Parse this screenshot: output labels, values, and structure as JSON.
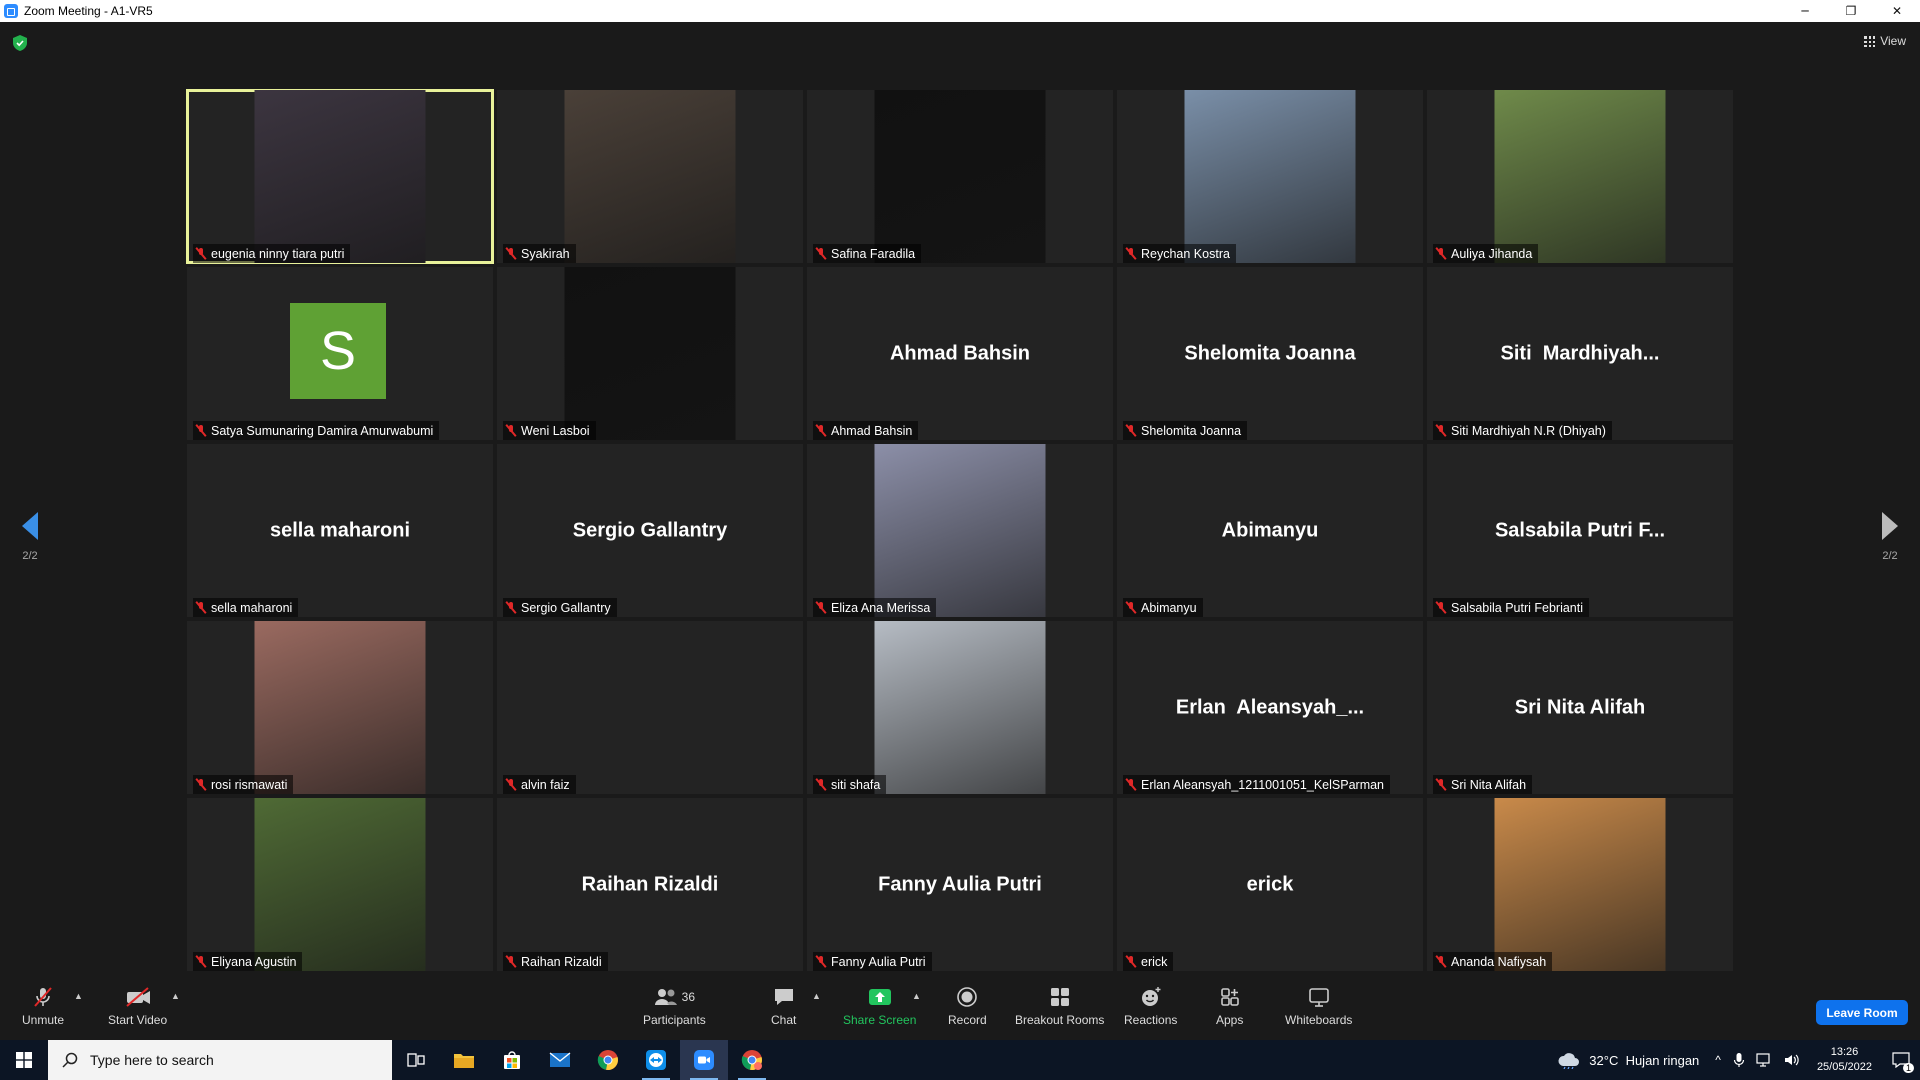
{
  "window": {
    "title": "Zoom Meeting - A1-VR5"
  },
  "view_label": "View",
  "pagination": {
    "left": "2/2",
    "right": "2/2"
  },
  "tiles": [
    {
      "display": "",
      "label": "eugenia ninny tiara putri",
      "type": "photo",
      "active": true,
      "photo_color": "#3c3540"
    },
    {
      "display": "",
      "label": "Syakirah",
      "type": "photo",
      "photo_color": "#4a4038"
    },
    {
      "display": "",
      "label": "Safina Faradila",
      "type": "photo",
      "photo_color": "#111111"
    },
    {
      "display": "",
      "label": "Reychan Kostra",
      "type": "photo",
      "photo_color": "#7a8fa8"
    },
    {
      "display": "",
      "label": "Auliya Jihanda",
      "type": "photo",
      "photo_color": "#6f8a4a"
    },
    {
      "display": "S",
      "label": "Satya Sumunaring Damira Amurwabumi",
      "type": "avatar"
    },
    {
      "display": "",
      "label": "Weni Lasboi",
      "type": "photo",
      "photo_color": "#111111"
    },
    {
      "display": "Ahmad Bahsin",
      "label": "Ahmad Bahsin",
      "type": "name"
    },
    {
      "display": "Shelomita Joanna",
      "label": "Shelomita Joanna",
      "type": "name"
    },
    {
      "display": "Siti  Mardhiyah...",
      "label": "Siti Mardhiyah N.R (Dhiyah)",
      "type": "name"
    },
    {
      "display": "sella maharoni",
      "label": "sella maharoni",
      "type": "name"
    },
    {
      "display": "Sergio Gallantry",
      "label": "Sergio Gallantry",
      "type": "name"
    },
    {
      "display": "",
      "label": "Eliza Ana Merissa",
      "type": "photo",
      "photo_color": "#8c8fa8"
    },
    {
      "display": "Abimanyu",
      "label": "Abimanyu",
      "type": "name"
    },
    {
      "display": "Salsabila Putri F...",
      "label": "Salsabila Putri Febrianti",
      "type": "name"
    },
    {
      "display": "",
      "label": "rosi rismawati",
      "type": "photo",
      "photo_color": "#9a6a60"
    },
    {
      "display": "",
      "label": "alvin faiz",
      "type": "empty"
    },
    {
      "display": "",
      "label": "siti shafa",
      "type": "photo",
      "photo_color": "#b6bcc4"
    },
    {
      "display": "Erlan  Aleansyah_...",
      "label": "Erlan Aleansyah_1211001051_KelSParman",
      "type": "name"
    },
    {
      "display": "Sri Nita Alifah",
      "label": "Sri Nita Alifah",
      "type": "name"
    },
    {
      "display": "",
      "label": "Eliyana Agustin",
      "type": "photo",
      "photo_color": "#4f6a35"
    },
    {
      "display": "Raihan Rizaldi",
      "label": "Raihan Rizaldi",
      "type": "name"
    },
    {
      "display": "Fanny Aulia Putri",
      "label": "Fanny Aulia Putri",
      "type": "name"
    },
    {
      "display": "erick",
      "label": "erick",
      "type": "name"
    },
    {
      "display": "",
      "label": "Ananda Nafiysah",
      "type": "photo",
      "photo_color": "#c98a4a"
    }
  ],
  "toolbar": {
    "unmute": "Unmute",
    "start_video": "Start Video",
    "participants": "Participants",
    "participants_count": "36",
    "chat": "Chat",
    "share_screen": "Share Screen",
    "record": "Record",
    "breakout_rooms": "Breakout Rooms",
    "reactions": "Reactions",
    "apps": "Apps",
    "whiteboards": "Whiteboards",
    "leave": "Leave Room"
  },
  "taskbar": {
    "search_placeholder": "Type here to search",
    "weather": "32°C  Hujan ringan",
    "time": "13:26",
    "date": "25/05/2022",
    "notification_count": "1"
  },
  "colors": {
    "active_speaker": "#E9F29A",
    "leave": "#0e72ed",
    "share": "#22c55e",
    "muted": "#e02828"
  }
}
